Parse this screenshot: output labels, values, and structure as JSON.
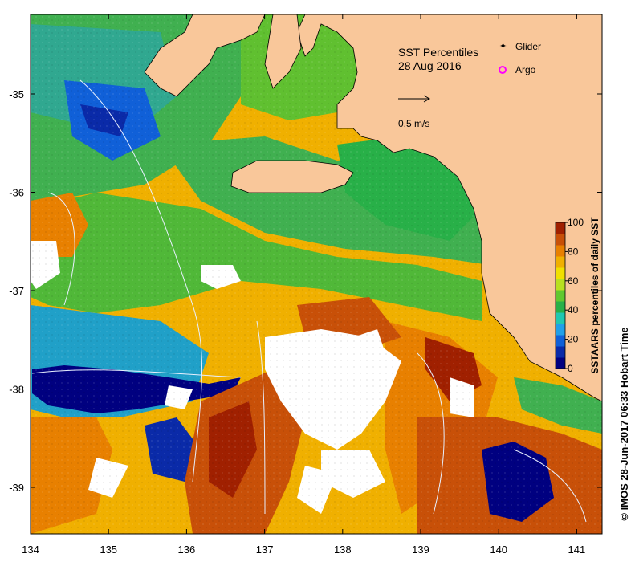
{
  "map": {
    "title": "SST Percentiles",
    "date": "28 Aug 2016",
    "legend": {
      "glider_label": "Glider",
      "argo_label": "Argo",
      "glider_color": "#ff00ff",
      "argo_color": "#ff00ff"
    },
    "current_scale_label": "0.5 m/s",
    "credit": "©  IMOS 28-Jun-2017 06:33 Hobart Time",
    "land_color": "#f9c79a",
    "nodata_color": "#ffffff",
    "x_axis": {
      "ticks": [
        134,
        135,
        136,
        137,
        138,
        139,
        140,
        141
      ],
      "labels": [
        "134",
        "135",
        "136",
        "137",
        "138",
        "139",
        "140",
        "141"
      ]
    },
    "y_axis": {
      "ticks": [
        -35,
        -36,
        -37,
        -38,
        -39
      ],
      "labels": [
        "-35",
        "-36",
        "-37",
        "-38",
        "-39"
      ]
    },
    "colorbar": {
      "title": "SSTAARS percentiles of daily  SST",
      "ticks": [
        "0",
        "20",
        "40",
        "60",
        "80",
        "100"
      ],
      "colors": [
        "#000080",
        "#0a2aa8",
        "#1060d8",
        "#20a0e8",
        "#20c8b0",
        "#28b048",
        "#60c830",
        "#b8e020",
        "#f0e000",
        "#f0b000",
        "#e88000",
        "#c85008",
        "#a02000"
      ]
    }
  }
}
